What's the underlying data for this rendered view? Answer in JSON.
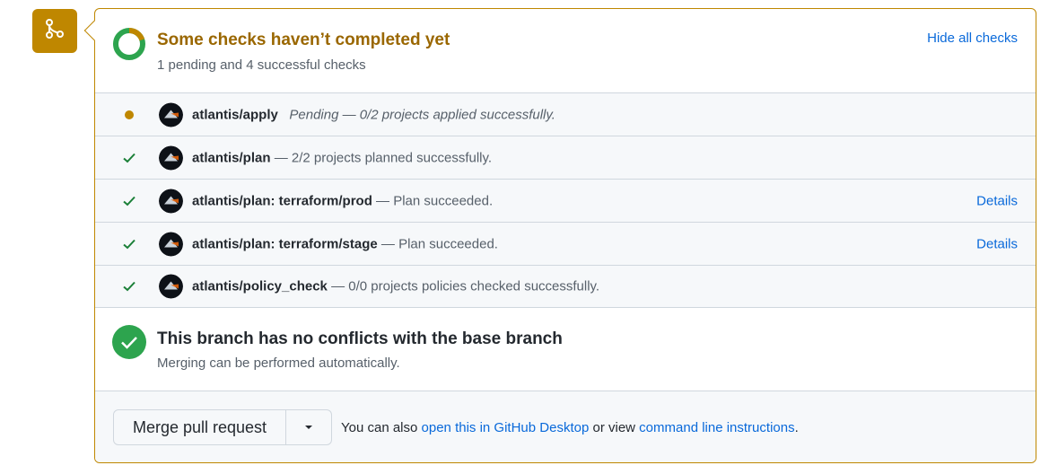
{
  "icons": {
    "branch": "git-merge-icon",
    "progress": "progress-ring-icon",
    "pending": "pending-dot-icon",
    "success": "check-icon",
    "avatar": "atlantis-avatar",
    "merged_ok": "check-circle-fill-icon",
    "caret": "triangle-down-icon"
  },
  "colors": {
    "attention": "#bf8700",
    "attention_text": "#9a6700",
    "success": "#2da44e",
    "link": "#0969da"
  },
  "checks_summary": {
    "title": "Some checks haven’t completed yet",
    "subtitle": "1 pending and 4 successful checks",
    "hide_label": "Hide all checks",
    "progress": {
      "pending": 1,
      "successful": 4
    }
  },
  "checks": [
    {
      "state": "pending",
      "name": "atlantis/apply",
      "separator": "",
      "description": "Pending — 0/2 projects applied successfully.",
      "details": ""
    },
    {
      "state": "success",
      "name": "atlantis/plan",
      "separator": " — ",
      "description": "2/2 projects planned successfully.",
      "details": ""
    },
    {
      "state": "success",
      "name": "atlantis/plan: terraform/prod",
      "separator": " — ",
      "description": "Plan succeeded.",
      "details": "Details"
    },
    {
      "state": "success",
      "name": "atlantis/plan: terraform/stage",
      "separator": " — ",
      "description": "Plan succeeded.",
      "details": "Details"
    },
    {
      "state": "success",
      "name": "atlantis/policy_check",
      "separator": " — ",
      "description": "0/0 projects policies checked successfully.",
      "details": ""
    }
  ],
  "merge_status": {
    "title": "This branch has no conflicts with the base branch",
    "subtitle": "Merging can be performed automatically."
  },
  "merge_footer": {
    "button_label": "Merge pull request",
    "text_before": "You can also ",
    "desktop_link": "open this in GitHub Desktop",
    "text_middle": " or view ",
    "cli_link": "command line instructions",
    "text_after": "."
  }
}
